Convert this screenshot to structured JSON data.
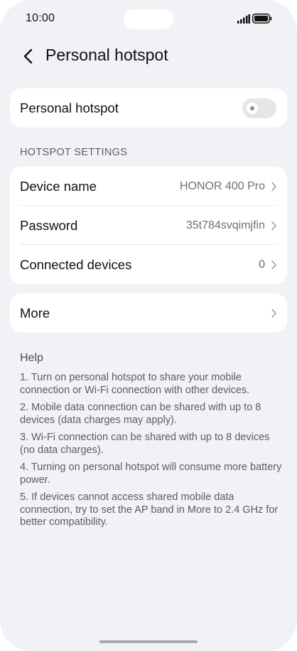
{
  "status_bar": {
    "time": "10:00"
  },
  "header": {
    "title": "Personal hotspot",
    "back_icon": "chevron-left-icon"
  },
  "hotspot_toggle": {
    "label": "Personal hotspot",
    "enabled": false
  },
  "settings": {
    "section_title": "HOTSPOT SETTINGS",
    "rows": [
      {
        "label": "Device name",
        "value": "HONOR 400 Pro"
      },
      {
        "label": "Password",
        "value": "35t784svqimjfin"
      },
      {
        "label": "Connected devices",
        "value": "0"
      }
    ]
  },
  "more": {
    "label": "More"
  },
  "help": {
    "title": "Help",
    "items": [
      "1. Turn on personal hotspot to share your mobile connection or Wi-Fi connection with other devices.",
      "2. Mobile data connection can be shared with up to 8 devices (data charges may apply).",
      "3. Wi-Fi connection can be shared with up to 8 devices (no data charges).",
      "4. Turning on personal hotspot will consume more battery power.",
      "5. If devices cannot access shared mobile data connection, try to set the AP band in More to 2.4 GHz for better compatibility."
    ]
  },
  "colors": {
    "background": "#f1f2f6",
    "card": "#ffffff",
    "primary_text": "#111111",
    "secondary_text": "#6f6f73",
    "toggle_off": "#e6e6e9"
  }
}
